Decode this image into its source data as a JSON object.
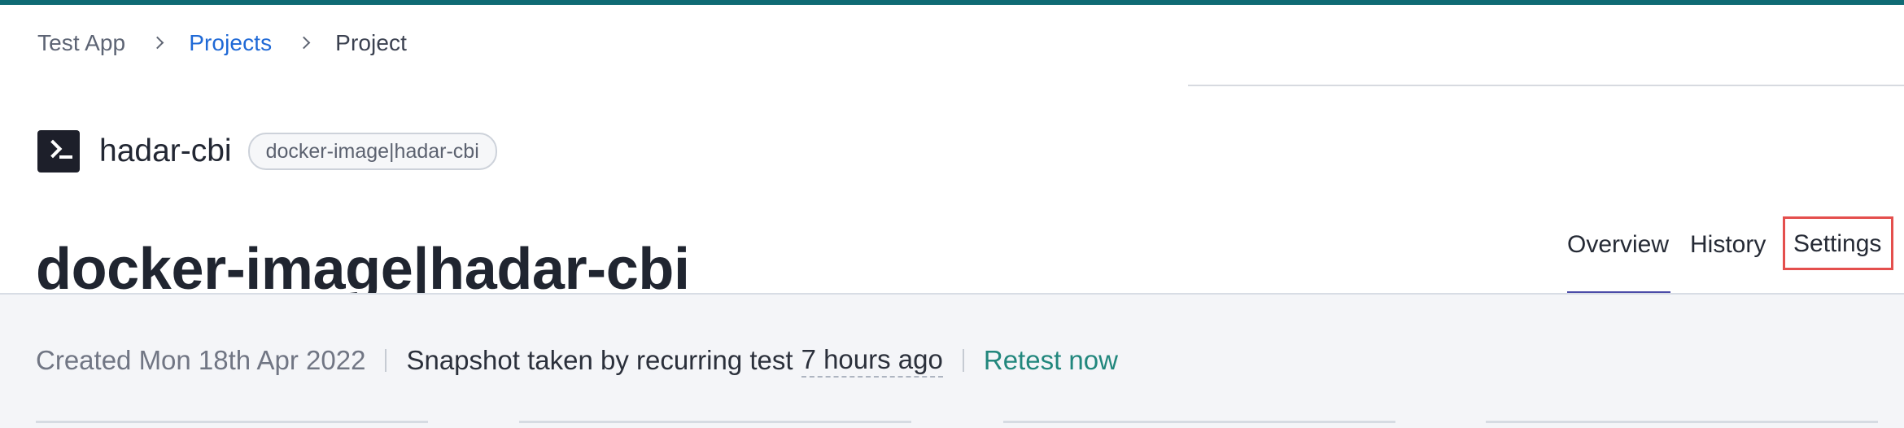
{
  "breadcrumb": {
    "items": [
      {
        "label": "Test App"
      },
      {
        "label": "Projects"
      },
      {
        "label": "Project"
      }
    ]
  },
  "project": {
    "icon": "terminal-icon",
    "name": "hadar-cbi",
    "tag": "docker-image|hadar-cbi",
    "title": "docker-image|hadar-cbi"
  },
  "tabs": [
    {
      "label": "Overview"
    },
    {
      "label": "History"
    },
    {
      "label": "Settings"
    }
  ],
  "summary": {
    "created": "Created Mon 18th Apr 2022",
    "snapshot_prefix": "Snapshot taken by recurring test",
    "time_ago": "7 hours ago",
    "retest": "Retest now"
  },
  "colors": {
    "top_accent": "#0f6b74",
    "breadcrumb_link": "#1f69d6",
    "active_tab_underline": "#4b4ba8",
    "highlight_border": "#e44f4d",
    "retest_link": "#22877d"
  }
}
